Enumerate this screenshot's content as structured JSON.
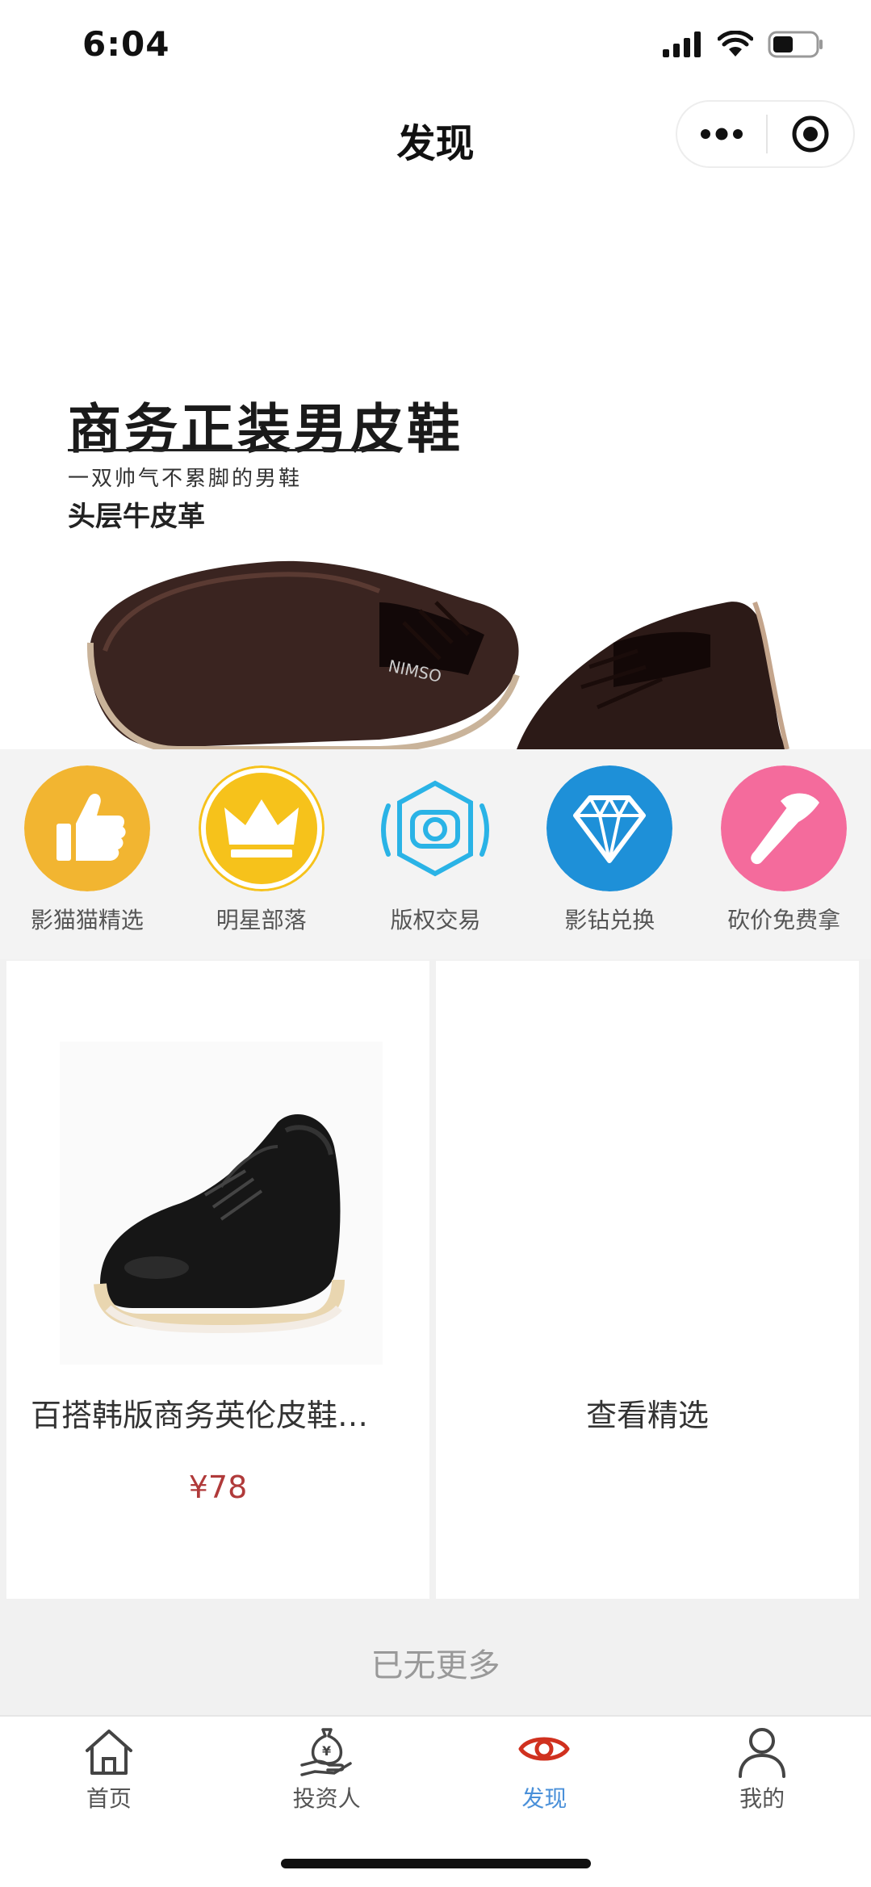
{
  "status": {
    "time": "6:04"
  },
  "nav": {
    "title": "发现",
    "more_icon": "more-dots-icon",
    "close_icon": "target-circle-icon"
  },
  "banner": {
    "title": "商务正装男皮鞋",
    "subtitle": "一双帅气不累脚的男鞋",
    "tagline": "头层牛皮革",
    "brand_mark": "NIMSO"
  },
  "menu": {
    "items": [
      {
        "label": "影猫猫精选",
        "icon": "thumbs-up-icon",
        "color": "#F2B531"
      },
      {
        "label": "明星部落",
        "icon": "crown-icon",
        "color": "#F6C21B"
      },
      {
        "label": "版权交易",
        "icon": "camera-shield-icon",
        "color": "#2AB3E6"
      },
      {
        "label": "影钻兑换",
        "icon": "diamond-icon",
        "color": "#1E90D8"
      },
      {
        "label": "砍价免费拿",
        "icon": "axe-icon",
        "color": "#F46B9C"
      }
    ]
  },
  "products": [
    {
      "name": "百搭韩版商务英伦皮鞋…",
      "price": "¥78"
    }
  ],
  "see_more_label": "查看精选",
  "end_text": "已无更多",
  "tabs": [
    {
      "label": "首页",
      "icon": "home-icon",
      "active": false
    },
    {
      "label": "投资人",
      "icon": "money-bag-hand-icon",
      "active": false
    },
    {
      "label": "发现",
      "icon": "eye-icon",
      "active": true
    },
    {
      "label": "我的",
      "icon": "user-icon",
      "active": false
    }
  ],
  "colors": {
    "active_tab": "#4A90D9",
    "active_icon": "#D0311F",
    "price": "#B03A3A"
  }
}
